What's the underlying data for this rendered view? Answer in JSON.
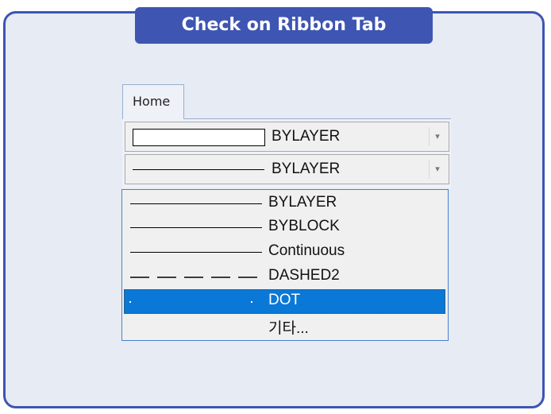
{
  "banner": {
    "title": "Check on Ribbon Tab"
  },
  "ribbon": {
    "tab_label": "Home"
  },
  "color_combo": {
    "value": "BYLAYER",
    "arrow": "▾"
  },
  "linetype_combo": {
    "value": "BYLAYER",
    "arrow": "▾"
  },
  "linetype_dropdown": {
    "options": [
      {
        "label": "BYLAYER",
        "line": "solid"
      },
      {
        "label": "BYBLOCK",
        "line": "solid"
      },
      {
        "label": "Continuous",
        "line": "solid"
      },
      {
        "label": "DASHED2",
        "line": "dashed"
      },
      {
        "label": "DOT",
        "line": "dot",
        "selected": true
      },
      {
        "label": "기타...",
        "line": "none"
      }
    ]
  },
  "colors": {
    "accent": "#3e55b2",
    "card_bg": "#e6ebf4",
    "selection": "#0a78d7"
  }
}
